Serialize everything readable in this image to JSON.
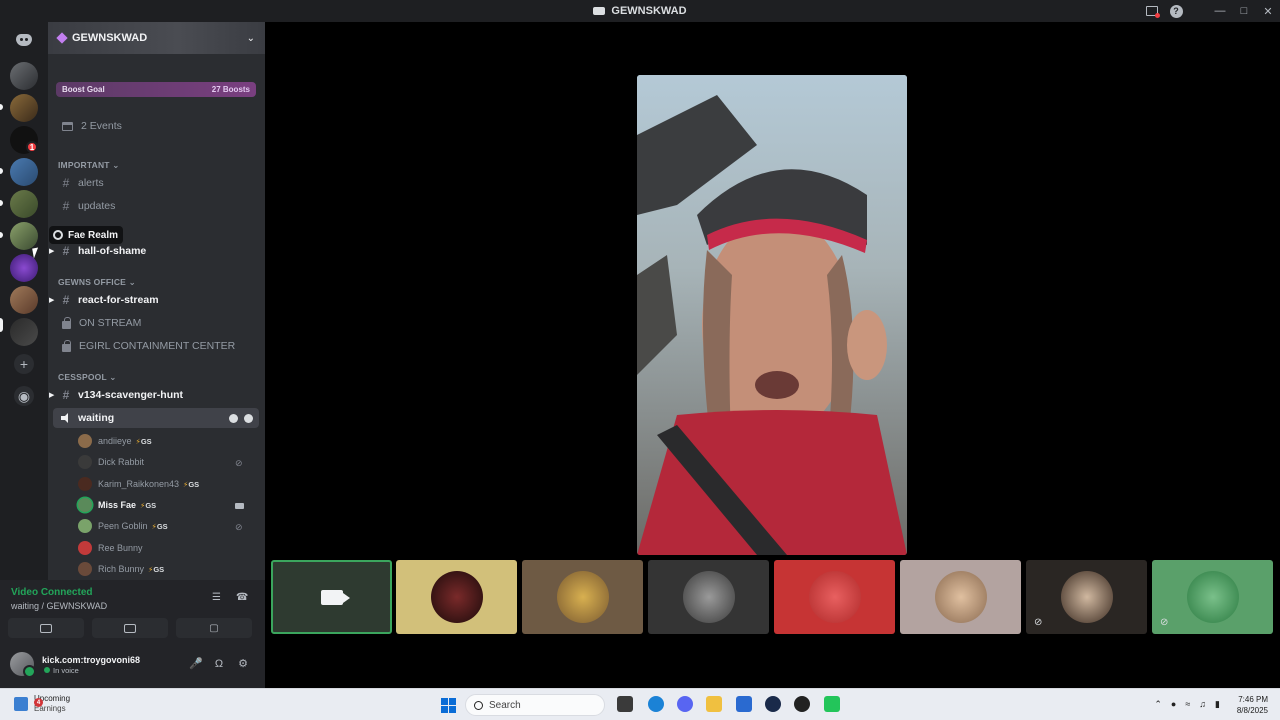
{
  "window": {
    "title": "GEWNSKWAD"
  },
  "server": {
    "name": "GEWNSKWAD"
  },
  "boost": {
    "label": "Boost Goal",
    "count": "27 Boosts"
  },
  "events": {
    "label": "2 Events"
  },
  "categories": [
    {
      "name": "IMPORTANT",
      "channels": [
        "alerts",
        "updates",
        "hall-of-shame"
      ]
    },
    {
      "name": "GEWNS OFFICE",
      "channels": [
        "react-for-stream",
        "ON STREAM",
        "EGIRL CONTAINMENT CENTER"
      ]
    },
    {
      "name": "CESSPOOL",
      "channels": [
        "v134-scavenger-hunt",
        "waiting"
      ]
    }
  ],
  "tooltip": {
    "label": "Fae Realm"
  },
  "voice_members": [
    {
      "name": "andiieye",
      "tag": "GS",
      "avatar_color": "#8b6b4a"
    },
    {
      "name": "Dick Rabbit",
      "tag": "",
      "avatar_color": "#3a3a3a"
    },
    {
      "name": "Karim_Raikkonen43",
      "tag": "GS",
      "avatar_color": "#4a2a20"
    },
    {
      "name": "Miss Fae",
      "tag": "GS",
      "avatar_color": "#5a8a5a"
    },
    {
      "name": "Peen Goblin",
      "tag": "GS",
      "avatar_color": "#7aa36a"
    },
    {
      "name": "Ree Bunny",
      "tag": "",
      "avatar_color": "#c23a3a"
    },
    {
      "name": "Rich Bunny",
      "tag": "GS",
      "avatar_color": "#6a4a3a"
    }
  ],
  "voice_panel": {
    "status": "Video Connected",
    "location": "waiting / GEWNSKWAD"
  },
  "user": {
    "name": "kick.com:troygovoni68",
    "status": "In voice"
  },
  "tiles": [
    {
      "bg": "#2e3a30",
      "kind": "camera"
    },
    {
      "bg": "#d2c07a",
      "pfp": "#3a1a1a"
    },
    {
      "bg": "#6e5a44",
      "pfp": "#c79a3a"
    },
    {
      "bg": "#343434",
      "pfp": "#6a6a6a"
    },
    {
      "bg": "#c63434",
      "pfp": "#e05050"
    },
    {
      "bg": "#b3a3a0",
      "pfp": "#c9a68a"
    },
    {
      "bg": "#2a2623",
      "pfp": "#5a4a40"
    },
    {
      "bg": "#5aa06a",
      "pfp": "#3a8a50"
    }
  ],
  "taskbar": {
    "weather_title": "Upcoming",
    "weather_sub": "Earnings",
    "weather_badge": "4",
    "search_placeholder": "Search",
    "time": "7:46 PM",
    "date": "8/8/2025"
  }
}
